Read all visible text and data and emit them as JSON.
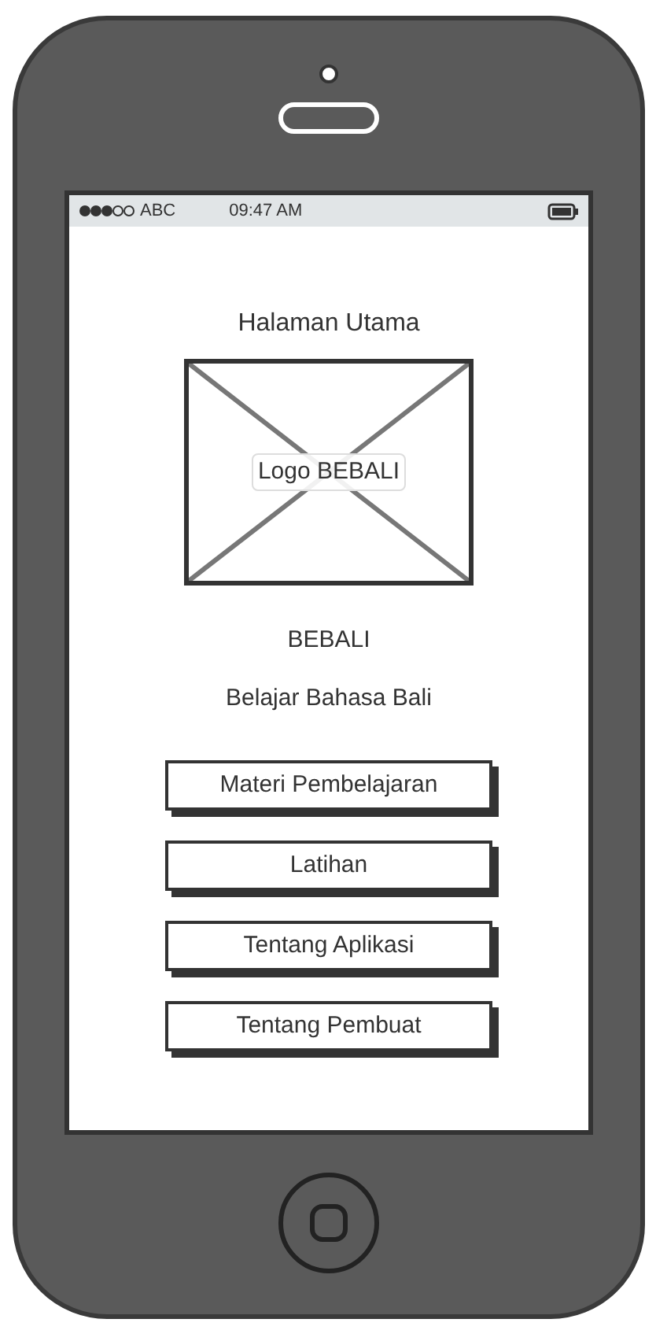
{
  "status_bar": {
    "carrier": "ABC",
    "time": "09:47 AM"
  },
  "title": "Halaman Utama",
  "logo_placeholder": {
    "label": "Logo BEBALI"
  },
  "app_name": "BEBALI",
  "tagline": "Belajar Bahasa Bali",
  "buttons": [
    "Materi Pembelajaran",
    "Latihan",
    "Tentang Aplikasi",
    "Tentang Pembuat"
  ]
}
